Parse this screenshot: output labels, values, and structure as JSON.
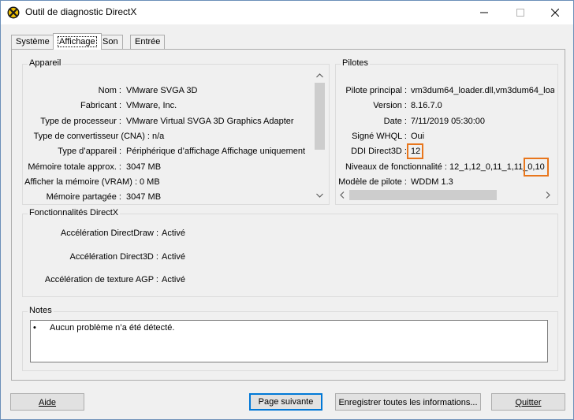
{
  "window": {
    "title": "Outil de diagnostic DirectX"
  },
  "tabs": [
    {
      "label": "Système"
    },
    {
      "label": "Affichage"
    },
    {
      "label": "Son"
    },
    {
      "label": "Entrée"
    }
  ],
  "device": {
    "title": "Appareil",
    "rows": [
      {
        "label": "Nom :",
        "value": "VMware SVGA 3D"
      },
      {
        "label": "Fabricant :",
        "value": "VMware, Inc."
      },
      {
        "label": "Type de processeur :",
        "value": "VMware Virtual SVGA 3D Graphics Adapter"
      },
      {
        "label": "Type de convertisseur (CNA) :",
        "value": "n/a"
      },
      {
        "label": "Type d’appareil :",
        "value": "Périphérique d’affichage Affichage uniquement"
      },
      {
        "label": "Mémoire totale approx. :",
        "value": "3047 MB"
      },
      {
        "label": "Afficher la mémoire (VRAM) :",
        "value": "0 MB"
      },
      {
        "label": "Mémoire partagée :",
        "value": "3047 MB"
      }
    ]
  },
  "drivers": {
    "title": "Pilotes",
    "rows": [
      {
        "label": "Pilote principal :",
        "value": "vm3dum64_loader.dll,vm3dum64_load"
      },
      {
        "label": "Version :",
        "value": "8.16.7.0"
      },
      {
        "label": "Date :",
        "value": "7/11/2019 05:30:00"
      },
      {
        "label": "Signé WHQL :",
        "value": "Oui"
      },
      {
        "label": "DDI Direct3D :",
        "value": "12"
      },
      {
        "label": "Niveaux de fonctionnalité :",
        "value": "12_1,12_0,11_1,11_0,10"
      },
      {
        "label": "Modèle de pilote :",
        "value": "WDDM 1.3"
      }
    ]
  },
  "features": {
    "title": "Fonctionnalités DirectX",
    "rows": [
      {
        "label": "Accélération DirectDraw :",
        "value": "Activé"
      },
      {
        "label": "Accélération Direct3D :",
        "value": "Activé"
      },
      {
        "label": "Accélération de texture AGP :",
        "value": "Activé"
      }
    ]
  },
  "notes": {
    "title": "Notes",
    "bullet": "•",
    "text": "Aucun problème n’a été détecté."
  },
  "buttons": {
    "help": "Aide",
    "next_page": "Page suivante",
    "save_all": "Enregistrer toutes les informations...",
    "exit": "Quitter"
  },
  "colors": {
    "highlight": "#e8761c",
    "focus_border": "#0078d7"
  }
}
